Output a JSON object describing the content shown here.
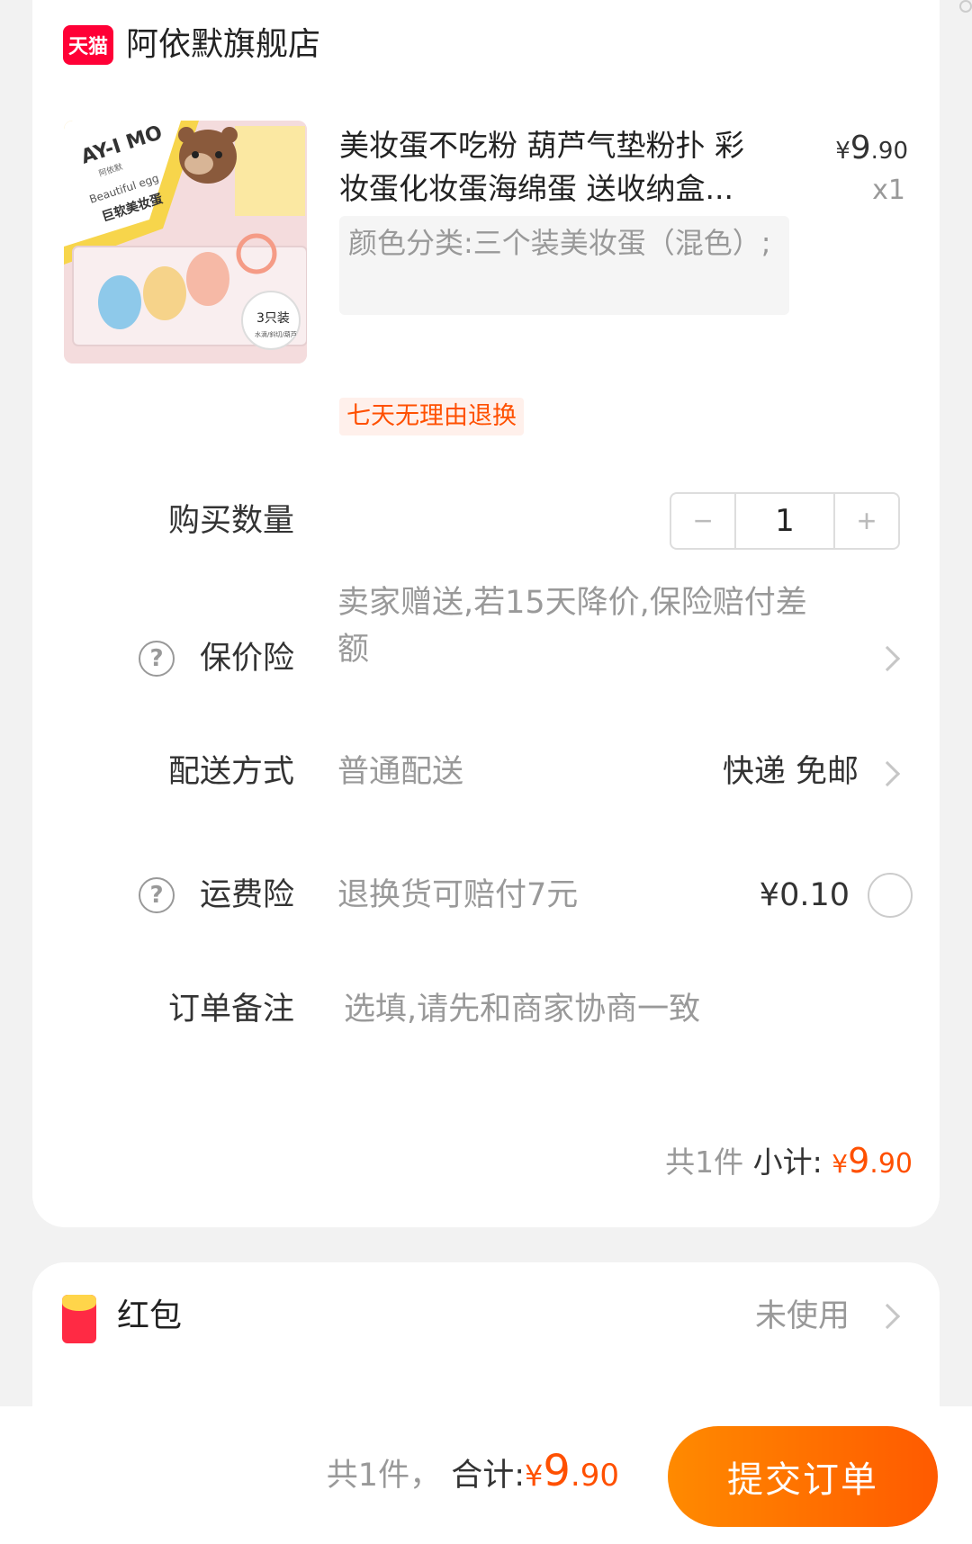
{
  "store": {
    "logo_text": "天猫",
    "name": "阿依默旗舰店"
  },
  "product": {
    "title": "美妆蛋不吃粉 葫芦气垫粉扑 彩妆蛋化妆蛋海绵蛋 送收纳盒...",
    "price_currency": "¥",
    "price_int": "9",
    "price_dec": ".90",
    "quantity_label": "x1",
    "sku": "颜色分类:三个装美妆蛋（混色）;",
    "service_badge": "七天无理由退换",
    "image_text": {
      "brand": "AY-I MO",
      "brand_cn": "阿依默",
      "en": "Beautiful egg",
      "cn": "巨软美妆蛋",
      "pack": "3只装",
      "pack_sub": "水滴/斜切/葫芦"
    }
  },
  "rows": {
    "quantity": {
      "label": "购买数量",
      "value": "1",
      "minus": "−",
      "plus": "+"
    },
    "price_protect": {
      "label": "保价险",
      "value": "卖家赠送,若15天降价,保险赔付差额"
    },
    "delivery": {
      "label": "配送方式",
      "value": "普通配送",
      "option": "快递 免邮"
    },
    "shipping_insurance": {
      "label": "运费险",
      "value": "退换货可赔付7元",
      "price": "¥0.10"
    },
    "note": {
      "label": "订单备注",
      "placeholder": "选填,请先和商家协商一致"
    }
  },
  "subtotal": {
    "count_text": "共1件",
    "label": "小计:",
    "currency": "¥",
    "int": "9",
    "dec": ".90"
  },
  "red_packet": {
    "label": "红包",
    "status": "未使用"
  },
  "bottom": {
    "count_text": "共1件，",
    "label": "合计:",
    "currency": "¥",
    "int": "9",
    "dec": ".90",
    "submit": "提交订单"
  }
}
